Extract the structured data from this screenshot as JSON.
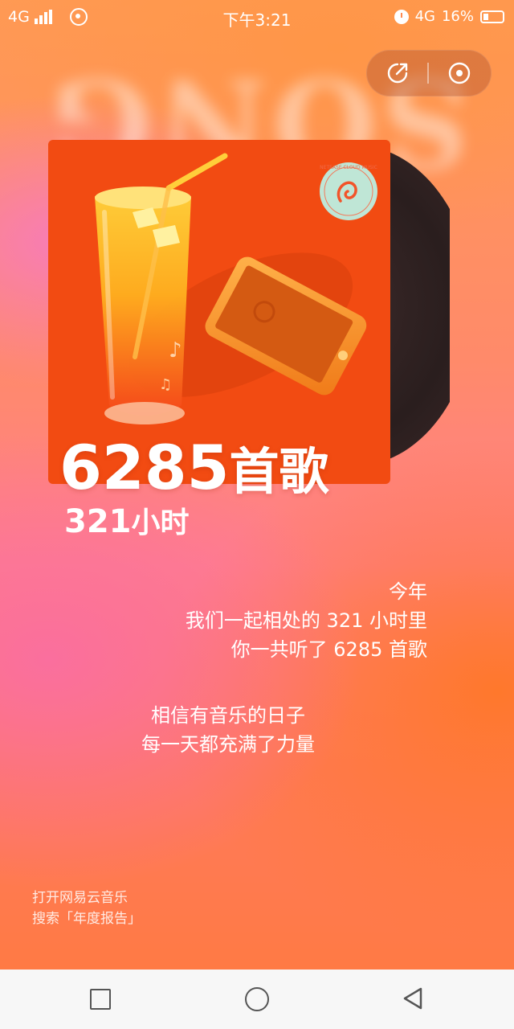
{
  "status_bar": {
    "network_left": "4G",
    "time": "下午3:21",
    "network_right": "4G",
    "battery": "16%"
  },
  "background_text": "SONG",
  "actions": {
    "share_icon": "share-icon",
    "target_icon": "target-icon"
  },
  "album": {
    "badge_text": "NETEASE CLOUD MUSIC"
  },
  "stats": {
    "songs_number": "6285",
    "songs_unit": "首歌",
    "hours_number": "321",
    "hours_unit": "小时"
  },
  "summary": {
    "line1": "今年",
    "line2": "我们一起相处的 321 小时里",
    "line3": "你一共听了 6285 首歌"
  },
  "summary2": {
    "line1": "相信有音乐的日子",
    "line2": "每一天都充满了力量"
  },
  "footer": {
    "line1": "打开网易云音乐",
    "line2": "搜索「年度报告」"
  },
  "nav": {
    "recent_icon": "square-icon",
    "home_icon": "circle-icon",
    "back_icon": "back-triangle-icon"
  },
  "colors": {
    "accent": "#f24b12",
    "nav_bg": "#f7f7f7"
  }
}
